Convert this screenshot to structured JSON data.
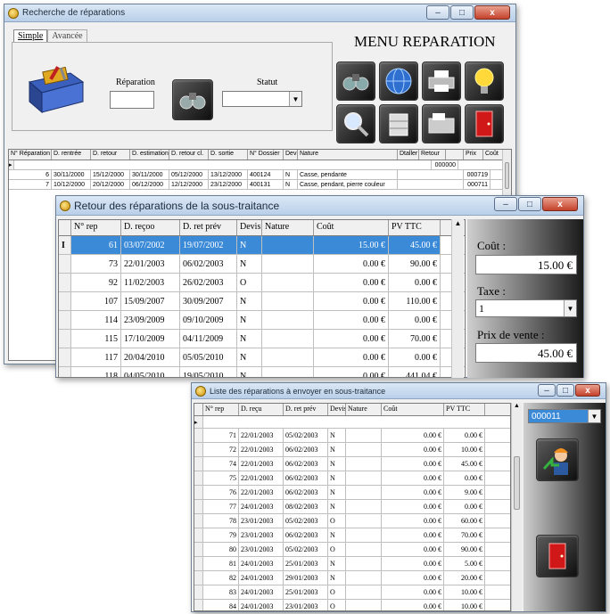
{
  "win1": {
    "title": "Recherche de réparations",
    "tabs": [
      "Simple",
      "Avancée"
    ],
    "menu_title": "MENU REPARATION",
    "reparation_label": "Réparation",
    "statut_label": "Statut",
    "headers": [
      "N° Réparation",
      "D. rentrée",
      "D. retour",
      "D. estimation",
      "D. retour cl.",
      "D. sortie",
      "N° Dossier",
      "Devis",
      "Nature",
      "Dtaller",
      "Retour",
      "",
      "Prix",
      "Coût"
    ],
    "rows": [
      {
        "n": "6",
        "c1": "30/11/2000",
        "c2": "15/12/2000",
        "c3": "30/11/2000",
        "c4": "05/12/2000",
        "c5": "13/12/2000",
        "c6": "400124",
        "devis": "N",
        "nature": "Casse, pendante",
        "ref": "000719"
      },
      {
        "n": "7",
        "c1": "10/12/2000",
        "c2": "20/12/2000",
        "c3": "06/12/2000",
        "c4": "12/12/2000",
        "c5": "23/12/2000",
        "c6": "400131",
        "devis": "N",
        "nature": "Casse, pendant, pierre couleur",
        "ref": "000711"
      }
    ],
    "top_ref": "000000"
  },
  "win2": {
    "title": "Retour des réparations de la sous-traitance",
    "headers": [
      "N° rep",
      "D. reçoo",
      "D. ret prév",
      "Devis",
      "Nature",
      "Coût",
      "PV TTC"
    ],
    "rows": [
      {
        "n": "61",
        "d1": "03/07/2002",
        "d2": "19/07/2002",
        "devis": "N",
        "nature": "",
        "cout": "15.00 €",
        "pv": "45.00 €"
      },
      {
        "n": "73",
        "d1": "22/01/2003",
        "d2": "06/02/2003",
        "devis": "N",
        "nature": "",
        "cout": "0.00 €",
        "pv": "90.00 €"
      },
      {
        "n": "92",
        "d1": "11/02/2003",
        "d2": "26/02/2003",
        "devis": "O",
        "nature": "",
        "cout": "0.00 €",
        "pv": "0.00 €"
      },
      {
        "n": "107",
        "d1": "15/09/2007",
        "d2": "30/09/2007",
        "devis": "N",
        "nature": "",
        "cout": "0.00 €",
        "pv": "110.00 €"
      },
      {
        "n": "114",
        "d1": "23/09/2009",
        "d2": "09/10/2009",
        "devis": "N",
        "nature": "",
        "cout": "0.00 €",
        "pv": "0.00 €"
      },
      {
        "n": "115",
        "d1": "17/10/2009",
        "d2": "04/11/2009",
        "devis": "N",
        "nature": "",
        "cout": "0.00 €",
        "pv": "70.00 €"
      },
      {
        "n": "117",
        "d1": "20/04/2010",
        "d2": "05/05/2010",
        "devis": "N",
        "nature": "",
        "cout": "0.00 €",
        "pv": "0.00 €"
      },
      {
        "n": "118",
        "d1": "04/05/2010",
        "d2": "19/05/2010",
        "devis": "N",
        "nature": "",
        "cout": "0.00 €",
        "pv": "441.04 €"
      }
    ],
    "cout_label": "Coût :",
    "cout_value": "15.00 €",
    "taxe_label": "Taxe :",
    "taxe_value": "1",
    "pv_label": "Prix de vente :",
    "pv_value": "45.00 €"
  },
  "win3": {
    "title": "Liste des réparations à envoyer en sous-traitance",
    "headers": [
      "N° rep",
      "D. reçu",
      "D. ret prév",
      "Devis",
      "Nature",
      "Coût",
      "PV TTC"
    ],
    "rows": [
      {
        "n": "71",
        "d1": "22/01/2003",
        "d2": "05/02/2003",
        "devis": "N",
        "cout": "0.00 €",
        "pv": "0.00 €"
      },
      {
        "n": "72",
        "d1": "22/01/2003",
        "d2": "06/02/2003",
        "devis": "N",
        "cout": "0.00 €",
        "pv": "10.00 €"
      },
      {
        "n": "74",
        "d1": "22/01/2003",
        "d2": "06/02/2003",
        "devis": "N",
        "cout": "0.00 €",
        "pv": "45.00 €"
      },
      {
        "n": "75",
        "d1": "22/01/2003",
        "d2": "06/02/2003",
        "devis": "N",
        "cout": "0.00 €",
        "pv": "0.00 €"
      },
      {
        "n": "76",
        "d1": "22/01/2003",
        "d2": "06/02/2003",
        "devis": "N",
        "cout": "0.00 €",
        "pv": "9.00 €"
      },
      {
        "n": "77",
        "d1": "24/01/2003",
        "d2": "08/02/2003",
        "devis": "N",
        "cout": "0.00 €",
        "pv": "0.00 €"
      },
      {
        "n": "78",
        "d1": "23/01/2003",
        "d2": "05/02/2003",
        "devis": "O",
        "cout": "0.00 €",
        "pv": "60.00 €"
      },
      {
        "n": "79",
        "d1": "23/01/2003",
        "d2": "06/02/2003",
        "devis": "N",
        "cout": "0.00 €",
        "pv": "70.00 €"
      },
      {
        "n": "80",
        "d1": "23/01/2003",
        "d2": "05/02/2003",
        "devis": "O",
        "cout": "0.00 €",
        "pv": "90.00 €"
      },
      {
        "n": "81",
        "d1": "24/01/2003",
        "d2": "25/01/2003",
        "devis": "N",
        "cout": "0.00 €",
        "pv": "5.00 €"
      },
      {
        "n": "82",
        "d1": "24/01/2003",
        "d2": "29/01/2003",
        "devis": "N",
        "cout": "0.00 €",
        "pv": "20.00 €"
      },
      {
        "n": "83",
        "d1": "24/01/2003",
        "d2": "25/01/2003",
        "devis": "O",
        "cout": "0.00 €",
        "pv": "10.00 €"
      },
      {
        "n": "84",
        "d1": "24/01/2003",
        "d2": "23/01/2003",
        "devis": "O",
        "cout": "0.00 €",
        "pv": "10.00 €"
      }
    ],
    "combo_value": "000011"
  }
}
